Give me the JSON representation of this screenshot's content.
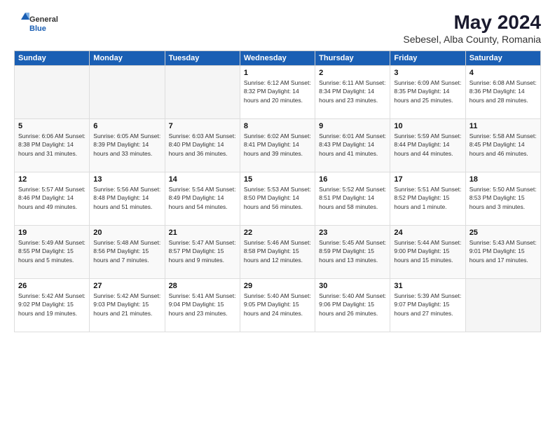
{
  "header": {
    "logo_general": "General",
    "logo_blue": "Blue",
    "title": "May 2024",
    "subtitle": "Sebesel, Alba County, Romania"
  },
  "days_of_week": [
    "Sunday",
    "Monday",
    "Tuesday",
    "Wednesday",
    "Thursday",
    "Friday",
    "Saturday"
  ],
  "weeks": [
    [
      {
        "day": "",
        "info": ""
      },
      {
        "day": "",
        "info": ""
      },
      {
        "day": "",
        "info": ""
      },
      {
        "day": "1",
        "info": "Sunrise: 6:12 AM\nSunset: 8:32 PM\nDaylight: 14 hours\nand 20 minutes."
      },
      {
        "day": "2",
        "info": "Sunrise: 6:11 AM\nSunset: 8:34 PM\nDaylight: 14 hours\nand 23 minutes."
      },
      {
        "day": "3",
        "info": "Sunrise: 6:09 AM\nSunset: 8:35 PM\nDaylight: 14 hours\nand 25 minutes."
      },
      {
        "day": "4",
        "info": "Sunrise: 6:08 AM\nSunset: 8:36 PM\nDaylight: 14 hours\nand 28 minutes."
      }
    ],
    [
      {
        "day": "5",
        "info": "Sunrise: 6:06 AM\nSunset: 8:38 PM\nDaylight: 14 hours\nand 31 minutes."
      },
      {
        "day": "6",
        "info": "Sunrise: 6:05 AM\nSunset: 8:39 PM\nDaylight: 14 hours\nand 33 minutes."
      },
      {
        "day": "7",
        "info": "Sunrise: 6:03 AM\nSunset: 8:40 PM\nDaylight: 14 hours\nand 36 minutes."
      },
      {
        "day": "8",
        "info": "Sunrise: 6:02 AM\nSunset: 8:41 PM\nDaylight: 14 hours\nand 39 minutes."
      },
      {
        "day": "9",
        "info": "Sunrise: 6:01 AM\nSunset: 8:43 PM\nDaylight: 14 hours\nand 41 minutes."
      },
      {
        "day": "10",
        "info": "Sunrise: 5:59 AM\nSunset: 8:44 PM\nDaylight: 14 hours\nand 44 minutes."
      },
      {
        "day": "11",
        "info": "Sunrise: 5:58 AM\nSunset: 8:45 PM\nDaylight: 14 hours\nand 46 minutes."
      }
    ],
    [
      {
        "day": "12",
        "info": "Sunrise: 5:57 AM\nSunset: 8:46 PM\nDaylight: 14 hours\nand 49 minutes."
      },
      {
        "day": "13",
        "info": "Sunrise: 5:56 AM\nSunset: 8:48 PM\nDaylight: 14 hours\nand 51 minutes."
      },
      {
        "day": "14",
        "info": "Sunrise: 5:54 AM\nSunset: 8:49 PM\nDaylight: 14 hours\nand 54 minutes."
      },
      {
        "day": "15",
        "info": "Sunrise: 5:53 AM\nSunset: 8:50 PM\nDaylight: 14 hours\nand 56 minutes."
      },
      {
        "day": "16",
        "info": "Sunrise: 5:52 AM\nSunset: 8:51 PM\nDaylight: 14 hours\nand 58 minutes."
      },
      {
        "day": "17",
        "info": "Sunrise: 5:51 AM\nSunset: 8:52 PM\nDaylight: 15 hours\nand 1 minute."
      },
      {
        "day": "18",
        "info": "Sunrise: 5:50 AM\nSunset: 8:53 PM\nDaylight: 15 hours\nand 3 minutes."
      }
    ],
    [
      {
        "day": "19",
        "info": "Sunrise: 5:49 AM\nSunset: 8:55 PM\nDaylight: 15 hours\nand 5 minutes."
      },
      {
        "day": "20",
        "info": "Sunrise: 5:48 AM\nSunset: 8:56 PM\nDaylight: 15 hours\nand 7 minutes."
      },
      {
        "day": "21",
        "info": "Sunrise: 5:47 AM\nSunset: 8:57 PM\nDaylight: 15 hours\nand 9 minutes."
      },
      {
        "day": "22",
        "info": "Sunrise: 5:46 AM\nSunset: 8:58 PM\nDaylight: 15 hours\nand 12 minutes."
      },
      {
        "day": "23",
        "info": "Sunrise: 5:45 AM\nSunset: 8:59 PM\nDaylight: 15 hours\nand 13 minutes."
      },
      {
        "day": "24",
        "info": "Sunrise: 5:44 AM\nSunset: 9:00 PM\nDaylight: 15 hours\nand 15 minutes."
      },
      {
        "day": "25",
        "info": "Sunrise: 5:43 AM\nSunset: 9:01 PM\nDaylight: 15 hours\nand 17 minutes."
      }
    ],
    [
      {
        "day": "26",
        "info": "Sunrise: 5:42 AM\nSunset: 9:02 PM\nDaylight: 15 hours\nand 19 minutes."
      },
      {
        "day": "27",
        "info": "Sunrise: 5:42 AM\nSunset: 9:03 PM\nDaylight: 15 hours\nand 21 minutes."
      },
      {
        "day": "28",
        "info": "Sunrise: 5:41 AM\nSunset: 9:04 PM\nDaylight: 15 hours\nand 23 minutes."
      },
      {
        "day": "29",
        "info": "Sunrise: 5:40 AM\nSunset: 9:05 PM\nDaylight: 15 hours\nand 24 minutes."
      },
      {
        "day": "30",
        "info": "Sunrise: 5:40 AM\nSunset: 9:06 PM\nDaylight: 15 hours\nand 26 minutes."
      },
      {
        "day": "31",
        "info": "Sunrise: 5:39 AM\nSunset: 9:07 PM\nDaylight: 15 hours\nand 27 minutes."
      },
      {
        "day": "",
        "info": ""
      }
    ]
  ]
}
